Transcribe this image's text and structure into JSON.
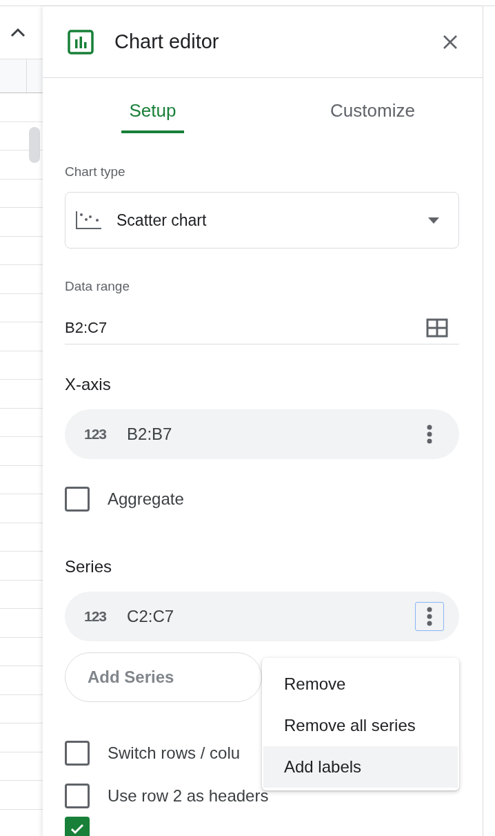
{
  "editor": {
    "title": "Chart editor"
  },
  "tabs": [
    {
      "label": "Setup",
      "selected": true
    },
    {
      "label": "Customize",
      "selected": false
    }
  ],
  "chart_type": {
    "label": "Chart type",
    "value": "Scatter chart"
  },
  "data_range": {
    "label": "Data range",
    "value": "B2:C7"
  },
  "x_axis": {
    "heading": "X-axis",
    "range": {
      "type_label": "123",
      "value": "B2:B7",
      "focused": false
    }
  },
  "aggregate": {
    "label": "Aggregate",
    "checked": false
  },
  "series": {
    "heading": "Series",
    "items": [
      {
        "type_label": "123",
        "value": "C2:C7",
        "focused": true
      }
    ],
    "add_button": "Add Series"
  },
  "options": [
    {
      "label": "Switch rows / colu",
      "checked": false
    },
    {
      "label": "Use row 2 as headers",
      "checked": false
    },
    {
      "checked": true
    }
  ],
  "menu": [
    {
      "label": "Remove",
      "highlighted": false
    },
    {
      "label": "Remove all series",
      "highlighted": false
    },
    {
      "label": "Add labels",
      "highlighted": true
    }
  ]
}
